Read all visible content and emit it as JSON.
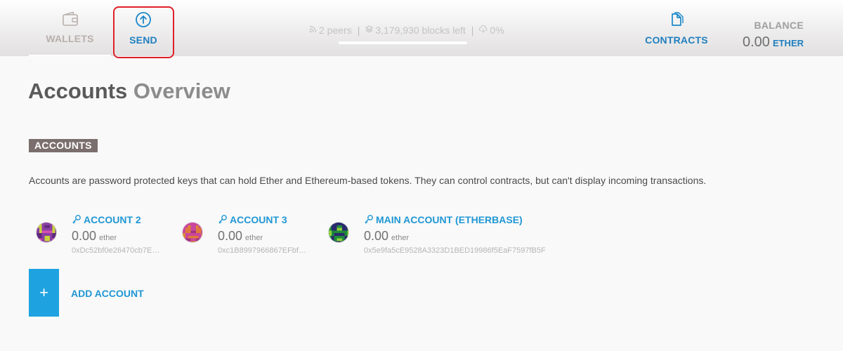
{
  "nav": {
    "wallets_label": "WALLETS",
    "send_label": "SEND",
    "contracts_label": "CONTRACTS"
  },
  "status": {
    "peers": "2 peers",
    "blocks_left": "3,179,930 blocks left",
    "progress_text": "0%",
    "sync_progress": 0
  },
  "balance": {
    "title": "BALANCE",
    "value": "0.00",
    "unit": "ETHER"
  },
  "page": {
    "title_bold": "Accounts",
    "title_light": "Overview"
  },
  "accounts_section": {
    "badge": "ACCOUNTS",
    "description": "Accounts are password protected keys that can hold Ether and Ethereum-based tokens. They can control contracts, but can't display incoming transactions."
  },
  "accounts": [
    {
      "name": "ACCOUNT 2",
      "balance": "0.00",
      "unit": "ether",
      "address": "0xDc52bf0e26470cb7E…"
    },
    {
      "name": "ACCOUNT 3",
      "balance": "0.00",
      "unit": "ether",
      "address": "0xc1B8997966867EFbf…"
    },
    {
      "name": "MAIN ACCOUNT (ETHERBASE)",
      "balance": "0.00",
      "unit": "ether",
      "address": "0x5e9fa5cE9528A3323D1BED19986f5EaF7597fB5F"
    }
  ],
  "add_account": {
    "button_symbol": "+",
    "label": "ADD ACCOUNT"
  },
  "colors": {
    "accent": "#1f97d4",
    "highlight": "#e0202a",
    "badge_bg": "#7b6f6d"
  }
}
